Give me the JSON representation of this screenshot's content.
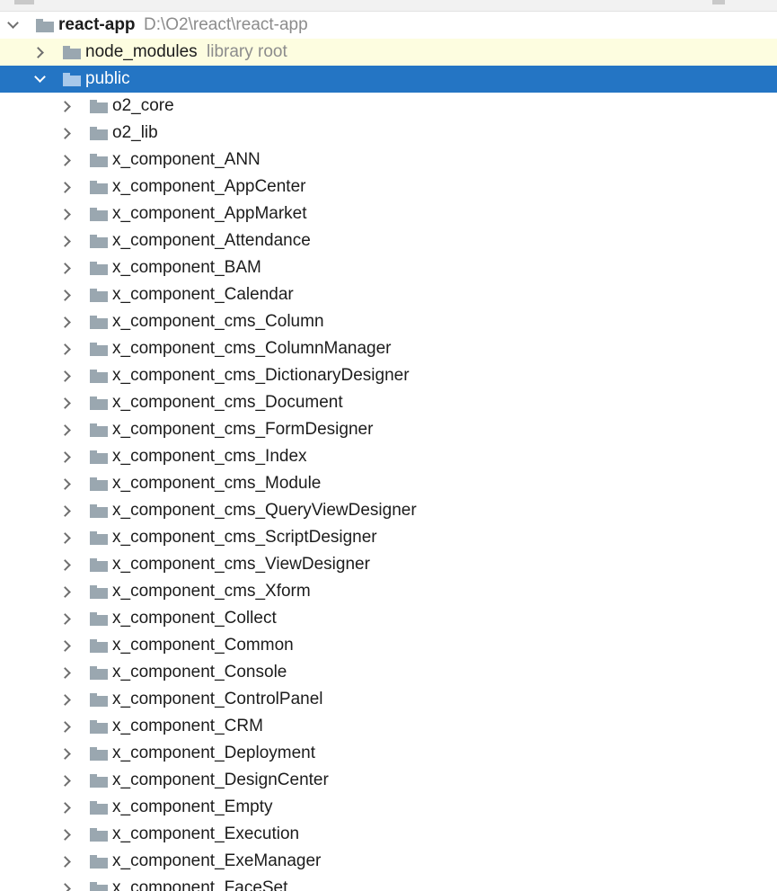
{
  "root": {
    "name": "react-app",
    "path": "D:\\O2\\react\\react-app",
    "expanded": true
  },
  "node_modules": {
    "name": "node_modules",
    "hint": "library root",
    "expanded": false
  },
  "public": {
    "name": "public",
    "expanded": true,
    "selected": true,
    "children": [
      "o2_core",
      "o2_lib",
      "x_component_ANN",
      "x_component_AppCenter",
      "x_component_AppMarket",
      "x_component_Attendance",
      "x_component_BAM",
      "x_component_Calendar",
      "x_component_cms_Column",
      "x_component_cms_ColumnManager",
      "x_component_cms_DictionaryDesigner",
      "x_component_cms_Document",
      "x_component_cms_FormDesigner",
      "x_component_cms_Index",
      "x_component_cms_Module",
      "x_component_cms_QueryViewDesigner",
      "x_component_cms_ScriptDesigner",
      "x_component_cms_ViewDesigner",
      "x_component_cms_Xform",
      "x_component_Collect",
      "x_component_Common",
      "x_component_Console",
      "x_component_ControlPanel",
      "x_component_CRM",
      "x_component_Deployment",
      "x_component_DesignCenter",
      "x_component_Empty",
      "x_component_Execution",
      "x_component_ExeManager",
      "x_component_FaceSet"
    ]
  },
  "colors": {
    "selection": "#2475c4",
    "hover_row": "#fdfde0",
    "folder_icon": "#9aa7b0",
    "hint_text": "#8c8c8c"
  },
  "icons": {
    "folder": "folder-icon",
    "collapsed": "chevron-right-icon",
    "expanded": "chevron-down-icon"
  }
}
